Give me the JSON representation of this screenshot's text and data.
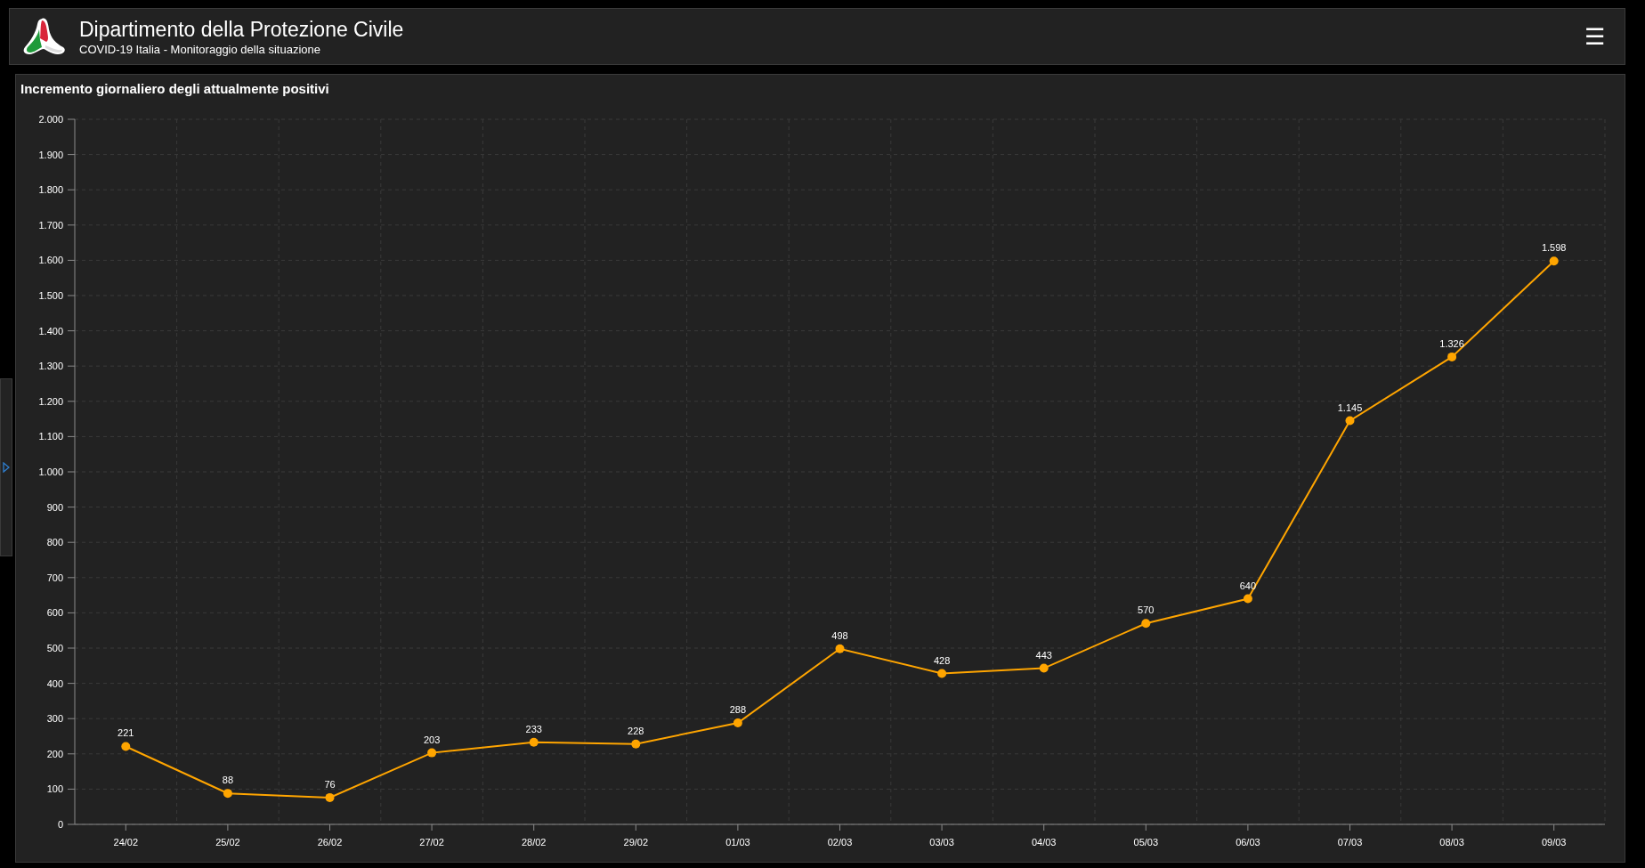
{
  "header": {
    "title": "Dipartimento della Protezione Civile",
    "subtitle": "COVID-19 Italia - Monitoraggio della situazione",
    "menu_icon": "☰"
  },
  "chart_panel": {
    "title": "Incremento giornaliero degli attualmente positivi",
    "chart_data": {
      "type": "line",
      "categories": [
        "24/02",
        "25/02",
        "26/02",
        "27/02",
        "28/02",
        "29/02",
        "01/03",
        "02/03",
        "03/03",
        "04/03",
        "05/03",
        "06/03",
        "07/03",
        "08/03",
        "09/03"
      ],
      "grid": true,
      "series": [
        {
          "color": "#ffa500",
          "marker": true,
          "values": [
            221,
            88,
            76,
            203,
            233,
            228,
            288,
            498,
            428,
            443,
            570,
            640,
            1145,
            1326,
            1598
          ]
        }
      ],
      "ylim": [
        0,
        2000
      ],
      "yticks": [
        {
          "value": 0,
          "label": "0"
        },
        {
          "value": 100,
          "label": "100"
        },
        {
          "value": 200,
          "label": "200"
        },
        {
          "value": 300,
          "label": "300"
        },
        {
          "value": 400,
          "label": "400"
        },
        {
          "value": 500,
          "label": "500"
        },
        {
          "value": 600,
          "label": "600"
        },
        {
          "value": 700,
          "label": "700"
        },
        {
          "value": 800,
          "label": "800"
        },
        {
          "value": 900,
          "label": "900"
        },
        {
          "value": 1000,
          "label": "1.000"
        },
        {
          "value": 1100,
          "label": "1.100"
        },
        {
          "value": 1200,
          "label": "1.200"
        },
        {
          "value": 1300,
          "label": "1.300"
        },
        {
          "value": 1400,
          "label": "1.400"
        },
        {
          "value": 1500,
          "label": "1.500"
        },
        {
          "value": 1600,
          "label": "1.600"
        },
        {
          "value": 1700,
          "label": "1.700"
        },
        {
          "value": 1800,
          "label": "1.800"
        },
        {
          "value": 1900,
          "label": "1.900"
        },
        {
          "value": 2000,
          "label": "2.000"
        }
      ],
      "value_labels": [
        "221",
        "88",
        "76",
        "203",
        "233",
        "228",
        "288",
        "498",
        "428",
        "443",
        "570",
        "640",
        "1.145",
        "1.326",
        "1.598"
      ]
    }
  }
}
